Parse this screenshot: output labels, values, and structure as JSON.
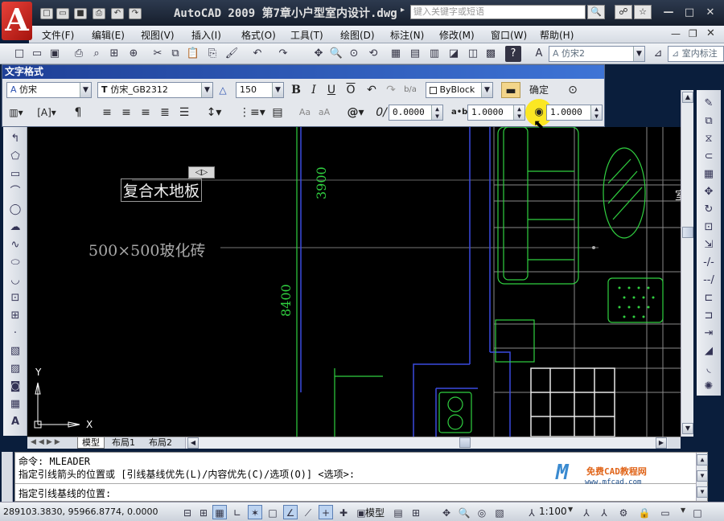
{
  "titlebar": {
    "title": "AutoCAD 2009  第7章小户型室内设计.dwg",
    "search_placeholder": "键入关键字或短语"
  },
  "menus": [
    "文件(F)",
    "编辑(E)",
    "视图(V)",
    "插入(I)",
    "格式(O)",
    "工具(T)",
    "绘图(D)",
    "标注(N)",
    "修改(M)",
    "窗口(W)",
    "帮助(H)"
  ],
  "stdbar": {
    "text_style": "仿宋2",
    "dim_style": "室内标注"
  },
  "textfmt": {
    "title": "文字格式",
    "style": "仿宋",
    "font": "仿宋_GB2312",
    "height": "150",
    "color": "ByBlock",
    "ok_label": "确定",
    "oblique": "0.0000",
    "tracking": "1.0000",
    "width_factor": "1.0000"
  },
  "drawing": {
    "label_floor": "复合木地板",
    "label_tile": "500×500玻化砖",
    "dim_3900": "3900",
    "dim_8400": "8400",
    "axis_y": "Y",
    "axis_x": "X",
    "room_label": "室"
  },
  "tabs": [
    "模型",
    "布局1",
    "布局2"
  ],
  "command": {
    "line1": "命令:  MLEADER",
    "line2": "指定引线箭头的位置或 [引线基线优先(L)/内容优先(C)/选项(O)] <选项>:",
    "line3": "指定引线基线的位置:",
    "watermark_url": "www.mfcad.com"
  },
  "status": {
    "coords": "289103.3830, 95966.8774, 0.0000",
    "model_label": "模型",
    "scale": "1:100"
  }
}
